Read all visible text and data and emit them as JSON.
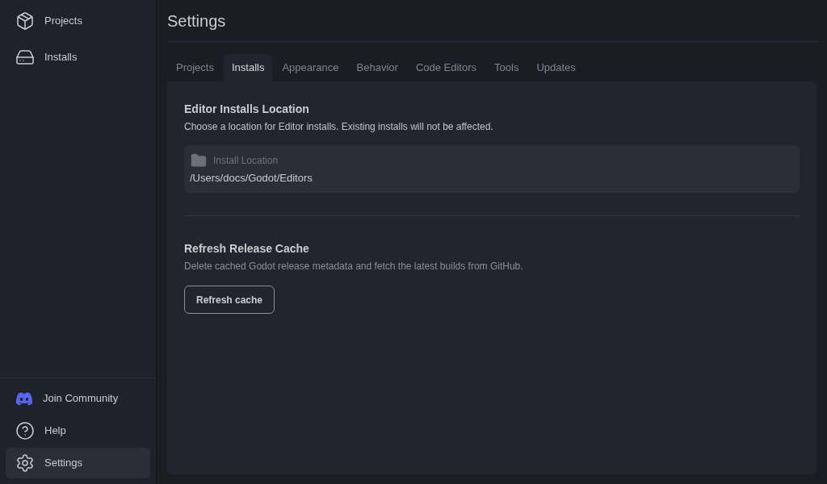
{
  "sidebar": {
    "top_items": [
      {
        "label": "Projects",
        "kind": "package",
        "selected": false
      },
      {
        "label": "Installs",
        "kind": "drive",
        "selected": false
      }
    ],
    "bottom_items": [
      {
        "label": "Join Community",
        "kind": "community",
        "selected": false
      },
      {
        "label": "Help",
        "kind": "help",
        "selected": false
      },
      {
        "label": "Settings",
        "kind": "settings",
        "selected": true
      }
    ]
  },
  "page_title": "Settings",
  "tabs": [
    {
      "label": "Projects",
      "selected": false
    },
    {
      "label": "Installs",
      "selected": true
    },
    {
      "label": "Appearance",
      "selected": false
    },
    {
      "label": "Behavior",
      "selected": false
    },
    {
      "label": "Code Editors",
      "selected": false
    },
    {
      "label": "Tools",
      "selected": false
    },
    {
      "label": "Updates",
      "selected": false
    }
  ],
  "sections": [
    {
      "kind": "location",
      "title": "Editor Installs Location",
      "description": "Choose a location for Editor installs. Existing installs will not be affected.",
      "field": {
        "label": "Install Location",
        "value": "/Users/docs/Godot/Editors"
      }
    },
    {
      "kind": "action",
      "title": "Refresh Release Cache",
      "description": "Delete cached Godot release metadata and fetch the latest builds from GitHub.",
      "button": "Refresh cache"
    }
  ]
}
